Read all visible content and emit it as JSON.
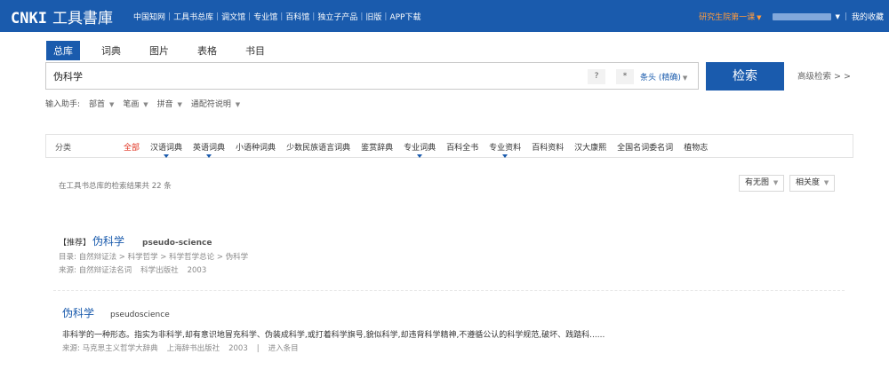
{
  "header": {
    "brand": "CNKI",
    "title": "工具書庫",
    "nav": [
      "中国知网",
      "工具书总库",
      "调文馆",
      "专业馆",
      "百科馆",
      "独立子产品",
      "旧版",
      "APP下载"
    ],
    "org": "研究生院第一课",
    "right_link": "我的收藏"
  },
  "search_tabs": [
    {
      "label": "总库",
      "active": true
    },
    {
      "label": "词典",
      "active": false
    },
    {
      "label": "图片",
      "active": false
    },
    {
      "label": "表格",
      "active": false
    },
    {
      "label": "书目",
      "active": false
    }
  ],
  "search": {
    "query": "伪科学",
    "q1": "?",
    "q2": "*",
    "field": "条头 (精确)",
    "button": "检索",
    "advanced": "高级检索 > >"
  },
  "helper": {
    "label": "输入助手:",
    "items": [
      "部首",
      "笔画",
      "拼音",
      "通配符说明"
    ]
  },
  "categories": {
    "label": "分类",
    "items": [
      {
        "label": "全部",
        "active": true,
        "marker": false
      },
      {
        "label": "汉语词典",
        "active": false,
        "marker": true
      },
      {
        "label": "英语词典",
        "active": false,
        "marker": true
      },
      {
        "label": "小语种词典",
        "active": false,
        "marker": false
      },
      {
        "label": "少数民族语言词典",
        "active": false,
        "marker": false
      },
      {
        "label": "鉴赏辞典",
        "active": false,
        "marker": false
      },
      {
        "label": "专业词典",
        "active": false,
        "marker": true
      },
      {
        "label": "百科全书",
        "active": false,
        "marker": false
      },
      {
        "label": "专业资料",
        "active": false,
        "marker": true
      },
      {
        "label": "百科资料",
        "active": false,
        "marker": false
      },
      {
        "label": "汉大康熙",
        "active": false,
        "marker": false
      },
      {
        "label": "全国名词委名词",
        "active": false,
        "marker": false
      },
      {
        "label": "植物志",
        "active": false,
        "marker": false
      }
    ]
  },
  "results_header": {
    "count_text": "在工具书总库的检索结果共 22 条",
    "sort_image": "有无图",
    "sort_relevance": "相关度"
  },
  "results": [
    {
      "badge": "【推荐】",
      "term": "伪科学",
      "english": "pseudo-science",
      "catalog": "目录: 自然辩证法 > 科学哲学 > 科学哲学总论 > 伪科学",
      "source_label": "来源: 自然辩证法名词",
      "publisher": "科学出版社",
      "year": "2003"
    },
    {
      "term": "伪科学",
      "english": "pseudoscience",
      "description": "非科学的一种形态。指实为非科学,却有意识地冒充科学、伪装成科学,或打着科学旗号,貌似科学,却违背科学精神,不遵循公认的科学规范,破坏、践踏科......",
      "source_label": "来源: 马克思主义哲学大辞典",
      "publisher": "上海辞书出版社",
      "year": "2003",
      "sep": "|",
      "entry_link": "进入条目"
    }
  ]
}
